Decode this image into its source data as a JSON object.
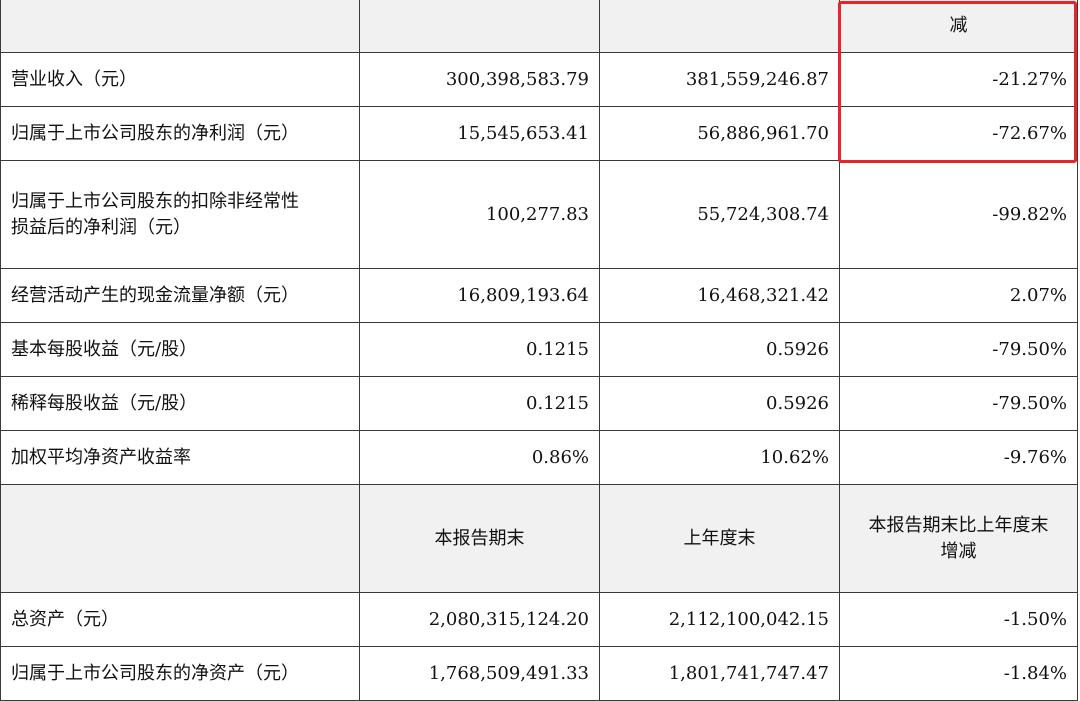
{
  "table1": {
    "header": {
      "c1": "",
      "c2": "",
      "c3": "",
      "c4": "减"
    },
    "rows": [
      {
        "label": "营业收入（元）",
        "current": "300,398,583.79",
        "previous": "381,559,246.87",
        "change": "-21.27%"
      },
      {
        "label": "归属于上市公司股东的净利润（元）",
        "current": "15,545,653.41",
        "previous": "56,886,961.70",
        "change": "-72.67%"
      },
      {
        "label_line1": "归属于上市公司股东的扣除非经常性",
        "label_line2": "损益后的净利润（元）",
        "current": "100,277.83",
        "previous": "55,724,308.74",
        "change": "-99.82%"
      },
      {
        "label": "经营活动产生的现金流量净额（元）",
        "current": "16,809,193.64",
        "previous": "16,468,321.42",
        "change": "2.07%"
      },
      {
        "label": "基本每股收益（元/股）",
        "current": "0.1215",
        "previous": "0.5926",
        "change": "-79.50%"
      },
      {
        "label": "稀释每股收益（元/股）",
        "current": "0.1215",
        "previous": "0.5926",
        "change": "-79.50%"
      },
      {
        "label": "加权平均净资产收益率",
        "current": "0.86%",
        "previous": "10.62%",
        "change": "-9.76%"
      }
    ]
  },
  "table2": {
    "header": {
      "c1": "",
      "c2": "本报告期末",
      "c3": "上年度末",
      "c4_line1": "本报告期末比上年度末",
      "c4_line2": "增减"
    },
    "rows": [
      {
        "label": "总资产（元）",
        "current": "2,080,315,124.20",
        "previous": "2,112,100,042.15",
        "change": "-1.50%"
      },
      {
        "label": "归属于上市公司股东的净资产（元）",
        "current": "1,768,509,491.33",
        "previous": "1,801,741,747.47",
        "change": "-1.84%"
      }
    ]
  },
  "colors": {
    "highlight": "#e8232a",
    "header_bg": "#f1f1f1",
    "border": "#3a3a3a"
  }
}
